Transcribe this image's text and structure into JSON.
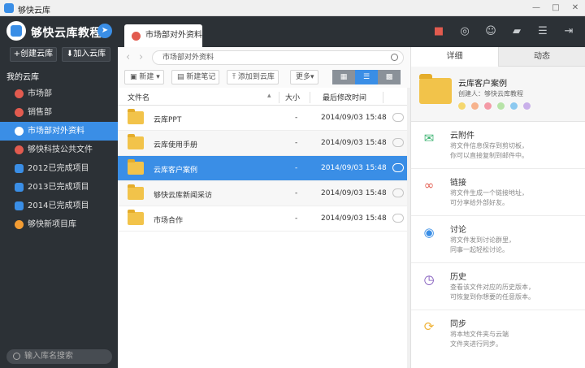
{
  "window": {
    "title": "够快云库"
  },
  "sidebar": {
    "brand": "够快云库教程",
    "create_btn": "+创建云库",
    "join_btn": "加入云库",
    "section_title": "我的云库",
    "items": [
      {
        "label": "市场部",
        "color": "red"
      },
      {
        "label": "销售部",
        "color": "red"
      },
      {
        "label": "市场部对外资料",
        "color": "red",
        "active": true
      },
      {
        "label": "够快科技公共文件",
        "color": "red"
      },
      {
        "label": "2012已完成项目",
        "color": "blue"
      },
      {
        "label": "2013已完成项目",
        "color": "blue"
      },
      {
        "label": "2014已完成项目",
        "color": "blue"
      },
      {
        "label": "够快新项目库",
        "color": "orange"
      }
    ],
    "search_placeholder": "输入库名搜索"
  },
  "topbar": {
    "active_tab": "市场部对外资料"
  },
  "nav": {
    "path": "市场部对外资料"
  },
  "toolbar": {
    "new_label": "新建",
    "new_note_label": "新建笔记",
    "add_to_lib_label": "添加到云库",
    "more_label": "更多"
  },
  "columns": {
    "name": "文件名",
    "size": "大小",
    "modified": "最后修改时间"
  },
  "files": [
    {
      "name": "云库PPT",
      "size": "-",
      "date": "2014/09/03 15:48"
    },
    {
      "name": "云库使用手册",
      "size": "-",
      "date": "2014/09/03 15:48"
    },
    {
      "name": "云库客户案例",
      "size": "-",
      "date": "2014/09/03 15:48",
      "selected": true
    },
    {
      "name": "够快云库新闻采访",
      "size": "-",
      "date": "2014/09/03 15:48"
    },
    {
      "name": "市场合作",
      "size": "-",
      "date": "2014/09/03 15:48"
    }
  ],
  "detail": {
    "tabs": [
      "详细",
      "动态"
    ],
    "title": "云库客户案例",
    "creator": "创建人：够快云库教程",
    "colors": [
      "#f5d76e",
      "#f7b38d",
      "#f49aa6",
      "#b7e3a7",
      "#8cc9f0",
      "#c9b0ea"
    ],
    "items": [
      {
        "title": "云附件",
        "line1": "将文件信息保存到剪切板，",
        "line2": "你可以直接复制到邮件中。",
        "icon": "mail-icon",
        "color": "#3cb371"
      },
      {
        "title": "链接",
        "line1": "将文件生成一个链接地址，",
        "line2": "可分享给外部好友。",
        "icon": "link-icon",
        "color": "#e25b4f"
      },
      {
        "title": "讨论",
        "line1": "将文件发到讨论群里，",
        "line2": "同事一起轻松讨论。",
        "icon": "chat-icon",
        "color": "#3a8ee6"
      },
      {
        "title": "历史",
        "line1": "查看该文件对应的历史版本，",
        "line2": "可恢复到你想要的任意版本。",
        "icon": "clock-icon",
        "color": "#7a4fb8"
      },
      {
        "title": "同步",
        "line1": "将本地文件夹与云端",
        "line2": "文件夹进行同步。",
        "icon": "sync-icon",
        "color": "#f0b43a"
      }
    ]
  }
}
